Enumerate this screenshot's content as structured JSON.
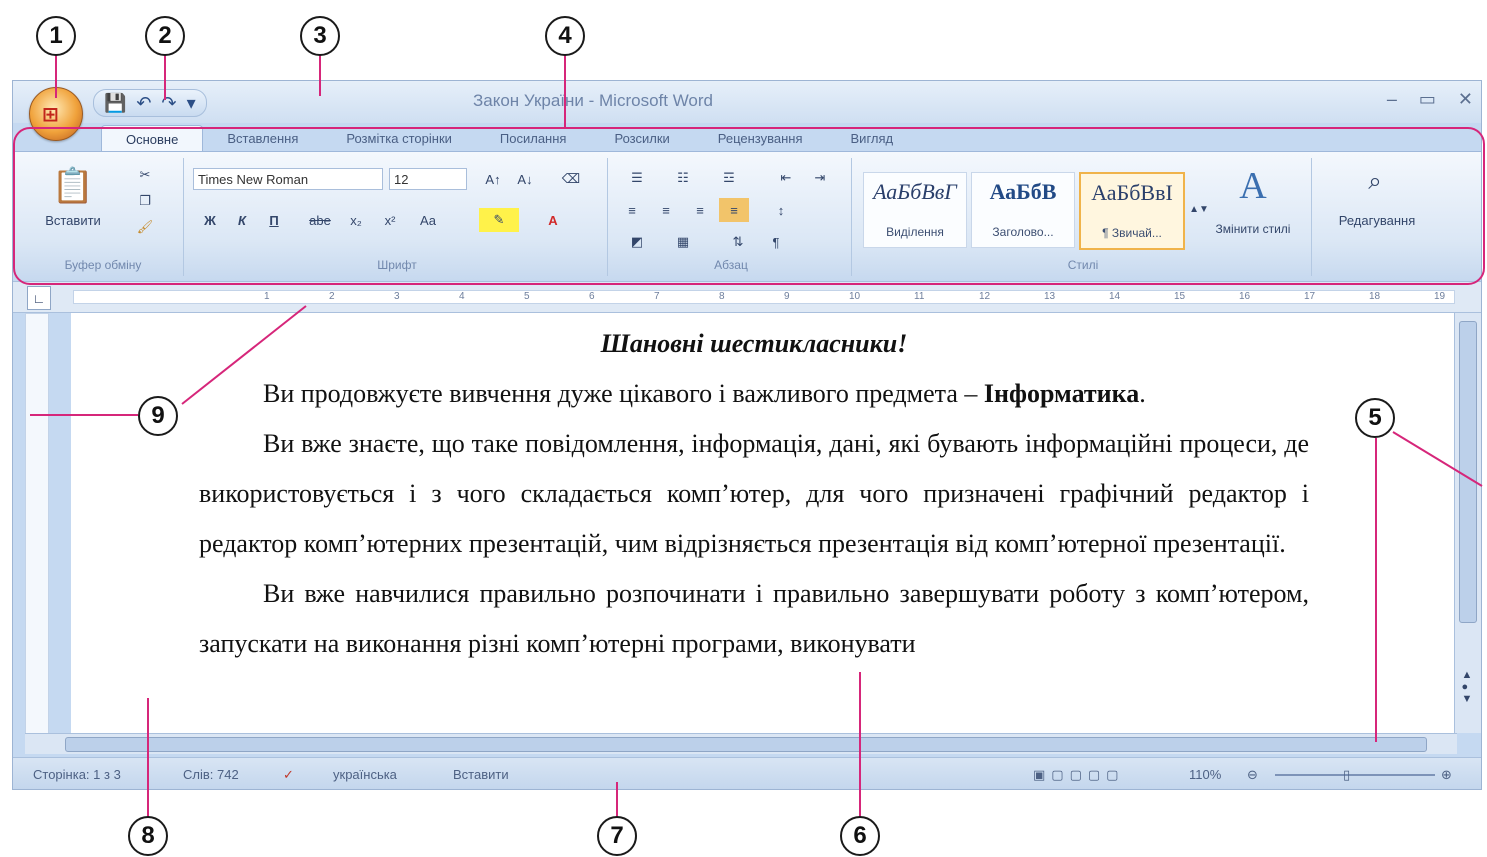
{
  "window": {
    "title": "Закон України - Microsoft Word",
    "controls": [
      "‒",
      "▭",
      "✕"
    ]
  },
  "quick_access": [
    "💾",
    "↶",
    "↷",
    "▾"
  ],
  "tabs": [
    "Основне",
    "Вставлення",
    "Розмітка сторінки",
    "Посилання",
    "Розсилки",
    "Рецензування",
    "Вигляд"
  ],
  "ribbon": {
    "clipboard": {
      "paste_label": "Вставити",
      "group_label": "Буфер обміну"
    },
    "font": {
      "font_name": "Times New Roman",
      "font_size": "12",
      "group_label": "Шрифт",
      "buttons": [
        "Ж",
        "К",
        "П",
        "abe",
        "x₂",
        "x²",
        "Aa"
      ]
    },
    "paragraph": {
      "group_label": "Абзац"
    },
    "styles": {
      "group_label": "Стилі",
      "tiles": [
        {
          "sample": "АаБбВвГ",
          "name": "Виділення"
        },
        {
          "sample": "АаБбВ",
          "name": "Заголово..."
        },
        {
          "sample": "АаБбВвІ",
          "name": "¶ Звичай..."
        }
      ],
      "change_label": "Змінити стилі"
    },
    "editing": {
      "label": "Редагування"
    }
  },
  "document": {
    "heading": "Шановні шестикласники!",
    "p1_a": "Ви продовжуєте вивчення дуже цікавого і важливого предмета –",
    "p1_b": "Інформатика",
    "p2": "Ви вже знаєте, що таке повідомлення, інформація, дані, які бувають інформаційні процеси, де використовується і з чого складається комп’ютер, для чого призначені графічний редактор і редактор комп’ютерних презентацій, чим відрізняється презентація від комп’ютерної презентації.",
    "p3": "Ви вже навчилися правильно розпочинати і правильно завершувати роботу з комп’ютером, запускати на виконання різні комп’ютерні програми, виконувати"
  },
  "status_bar": {
    "page": "Сторінка: 1 з 3",
    "words": "Слів: 742",
    "language": "українська",
    "mode": "Вставити",
    "zoom": "110%"
  },
  "callouts": [
    "1",
    "2",
    "3",
    "4",
    "5",
    "6",
    "7",
    "8",
    "9"
  ],
  "colors": {
    "callout_line": "#d6267a",
    "ribbon_bg": "#dbe7f5"
  }
}
